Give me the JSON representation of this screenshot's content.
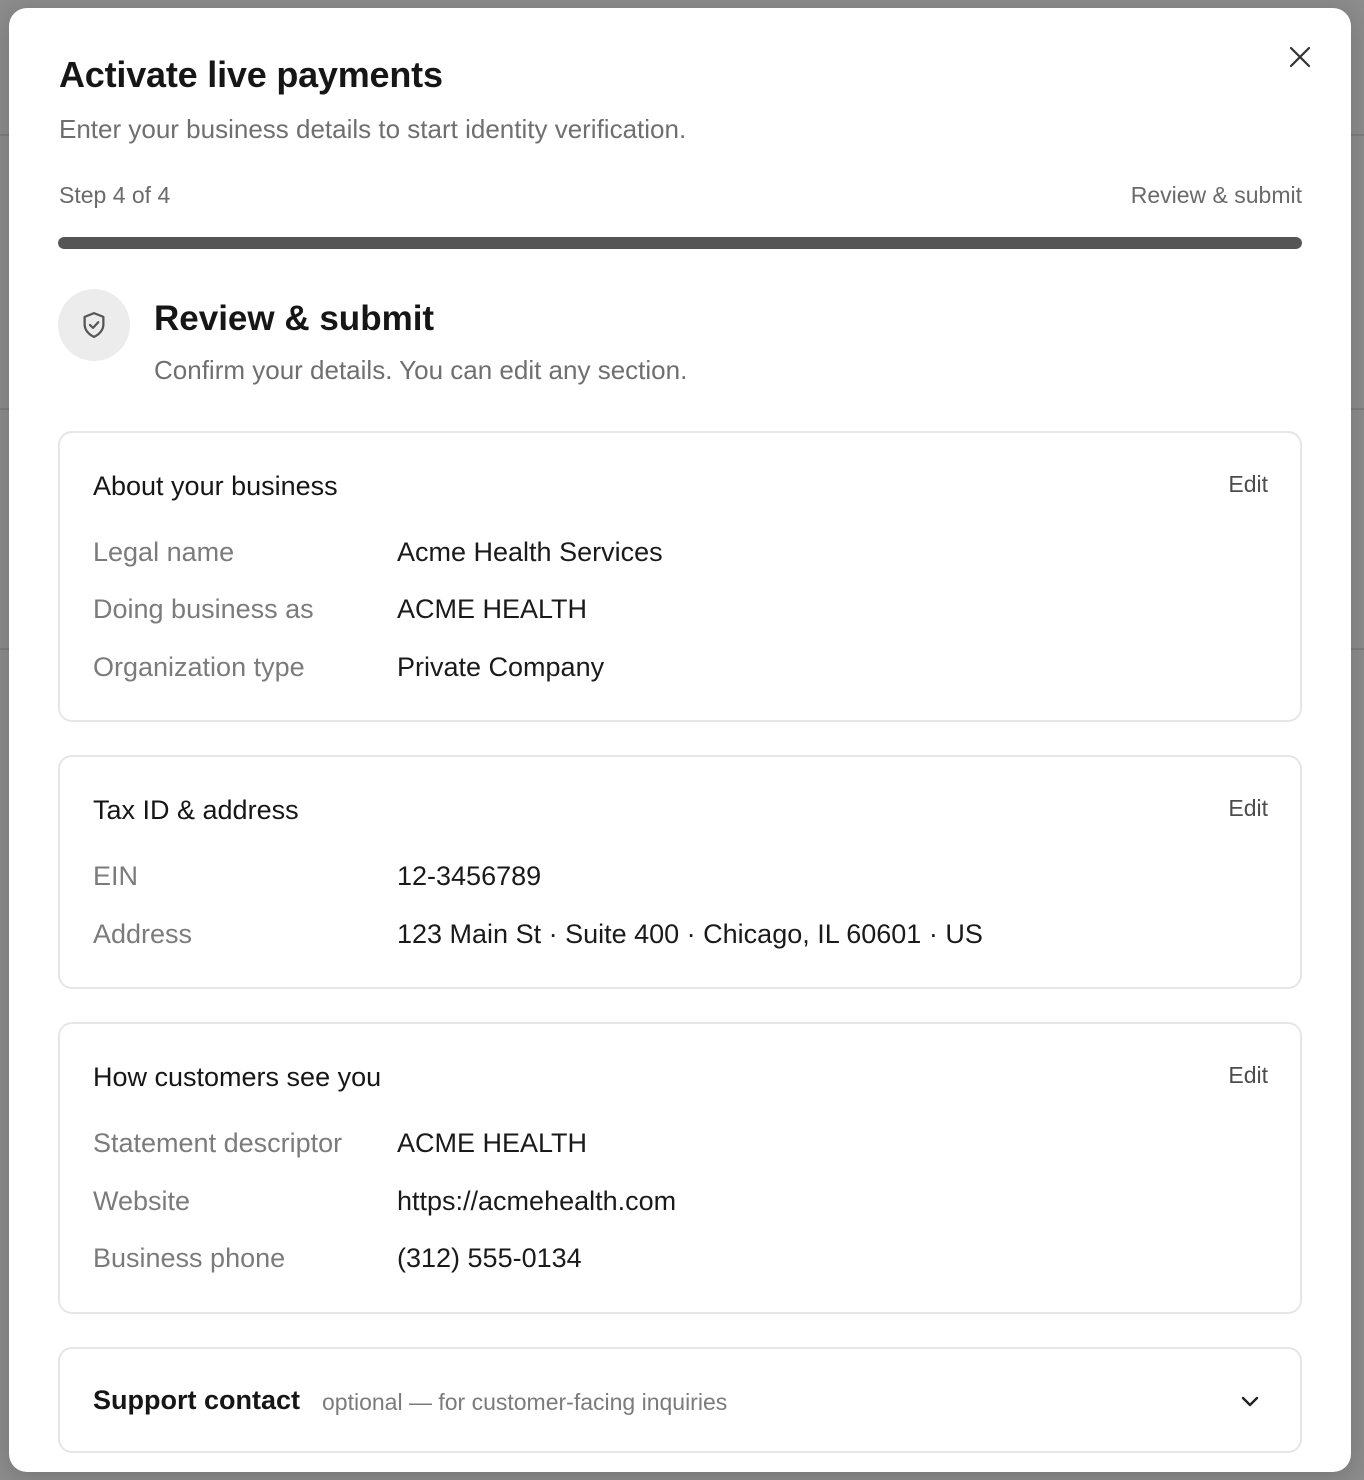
{
  "dialog": {
    "title": "Activate live payments",
    "subtitle": "Enter your business details to start identity verification.",
    "close_icon": "close-icon"
  },
  "progress": {
    "step_text": "Step 4 of 4",
    "step_name": "Review & submit",
    "fraction": 1.0
  },
  "section": {
    "icon": "shield-check-icon",
    "title": "Review & submit",
    "subtitle": "Confirm your details. You can edit any section."
  },
  "cards": {
    "business": {
      "title": "About your business",
      "edit_label": "Edit",
      "rows": [
        {
          "label": "Legal name",
          "value": "Acme Health Services"
        },
        {
          "label": "Doing business as",
          "value": "ACME HEALTH"
        },
        {
          "label": "Organization type",
          "value": "Private Company"
        }
      ]
    },
    "tax": {
      "title": "Tax ID & address",
      "edit_label": "Edit",
      "rows": [
        {
          "label": "EIN",
          "value": "12-3456789"
        },
        {
          "label": "Address",
          "value": "123 Main St · Suite 400 · Chicago, IL 60601 · US"
        }
      ]
    },
    "customers": {
      "title": "How customers see you",
      "edit_label": "Edit",
      "rows": [
        {
          "label": "Statement descriptor",
          "value": "ACME HEALTH"
        },
        {
          "label": "Website",
          "value": "https://acmehealth.com"
        },
        {
          "label": "Business phone",
          "value": "(312) 555-0134"
        }
      ]
    },
    "support": {
      "title": "Support contact",
      "hint": "optional — for customer-facing inquiries",
      "toggle_icon": "chevron-down-icon"
    }
  },
  "colors": {
    "progress_fill": "#555555",
    "progress_track": "#e4e4e4",
    "overlay": "#8c8c8c"
  }
}
